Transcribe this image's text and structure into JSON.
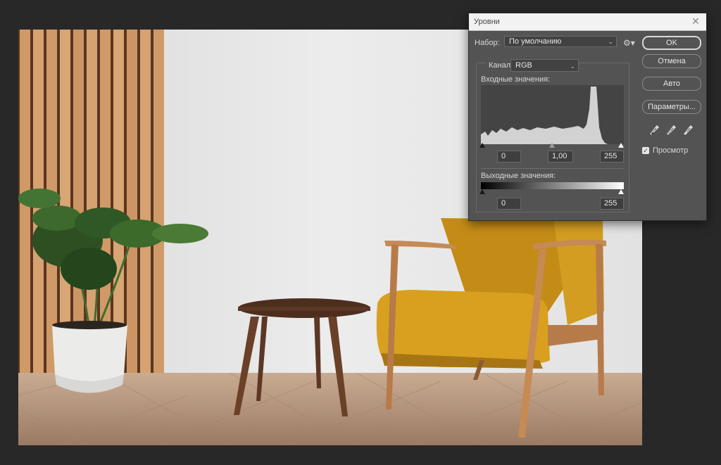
{
  "dialog": {
    "title": "Уровни",
    "close_glyph": "✕",
    "preset_label": "Набор:",
    "preset_value": "По умолчанию",
    "channel_label": "Канал:",
    "channel_value": "RGB",
    "input_label": "Входные значения:",
    "input_values": {
      "black": "0",
      "gamma": "1,00",
      "white": "255"
    },
    "output_label": "Выходные значения:",
    "output_values": {
      "black": "0",
      "white": "255"
    },
    "buttons": {
      "ok": "OK",
      "cancel": "Отмена",
      "auto": "Авто",
      "options": "Параметры..."
    },
    "preview_label": "Просмотр",
    "preview_checked": true,
    "icons": [
      "gear-icon",
      "eyedropper-black-icon",
      "eyedropper-gray-icon",
      "eyedropper-white-icon",
      "close-icon"
    ]
  },
  "colors": {
    "workspace": "#282828",
    "dialog_bg": "#535353",
    "wall": "#e7e7e7",
    "chair_fabric": "#d9a020",
    "wood_light": "#c68a55",
    "floor": "#b08d74"
  }
}
